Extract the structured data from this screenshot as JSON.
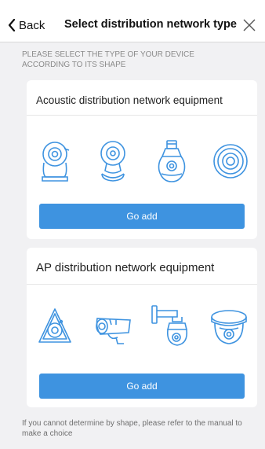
{
  "nav": {
    "back_label": "Back",
    "title": "Select distribution network type"
  },
  "hint": "PLEASE SELECT THE TYPE OF YOUR DEVICE ACCORDING TO ITS SHAPE",
  "sections": [
    {
      "title": "Acoustic distribution network equipment",
      "button": "Go add",
      "devices": [
        "pan-tilt-camera-icon",
        "cube-camera-icon",
        "bulb-camera-icon",
        "disc-camera-icon"
      ]
    },
    {
      "title": "AP distribution network equipment",
      "button": "Go add",
      "devices": [
        "fisheye-camera-icon",
        "bullet-camera-icon",
        "speed-dome-camera-icon",
        "dome-camera-icon"
      ]
    }
  ],
  "footer": "If you cannot determine by shape, please refer to the manual to make a choice",
  "colors": {
    "accent": "#3e93e0",
    "icon_stroke": "#3e93e0",
    "background": "#f1f1f3"
  }
}
